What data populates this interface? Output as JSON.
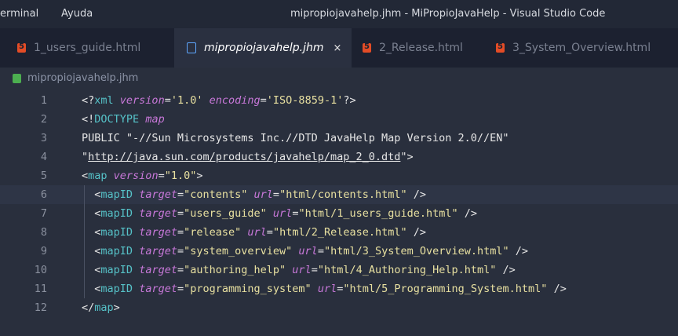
{
  "menu": {
    "terminal": "erminal",
    "help": "Ayuda"
  },
  "window": {
    "title": "mipropiojavahelp.jhm - MiPropioJavaHelp - Visual Studio Code"
  },
  "tabs": [
    {
      "label": "1_users_guide.html",
      "icon": "html5-icon",
      "active": false
    },
    {
      "label": "mipropiojavahelp.jhm",
      "icon": "file-icon",
      "active": true,
      "close": "×"
    },
    {
      "label": "2_Release.html",
      "icon": "html5-icon",
      "active": false
    },
    {
      "label": "3_System_Overview.html",
      "icon": "html5-icon",
      "active": false
    }
  ],
  "breadcrumb": {
    "file": "mipropiojavahelp.jhm"
  },
  "editor": {
    "current_line": 6,
    "line_numbers": [
      "1",
      "2",
      "3",
      "4",
      "5",
      "6",
      "7",
      "8",
      "9",
      "10",
      "11",
      "12"
    ],
    "lines": [
      [
        [
          "punc",
          "<?"
        ],
        [
          "tag",
          "xml"
        ],
        [
          "text",
          " "
        ],
        [
          "attr",
          "version"
        ],
        [
          "punc",
          "="
        ],
        [
          "str",
          "'1.0'"
        ],
        [
          "text",
          " "
        ],
        [
          "attr",
          "encoding"
        ],
        [
          "punc",
          "="
        ],
        [
          "str",
          "'ISO-8859-1'"
        ],
        [
          "punc",
          "?>"
        ]
      ],
      [
        [
          "punc",
          "<!"
        ],
        [
          "tag",
          "DOCTYPE"
        ],
        [
          "text",
          " "
        ],
        [
          "attr",
          "map"
        ]
      ],
      [
        [
          "text",
          "PUBLIC \"-//Sun Microsystems Inc.//DTD JavaHelp Map Version 2.0//EN\""
        ]
      ],
      [
        [
          "text",
          "\""
        ],
        [
          "url",
          "http://java.sun.com/products/javahelp/map_2_0.dtd"
        ],
        [
          "text",
          "\""
        ],
        [
          "punc",
          ">"
        ]
      ],
      [
        [
          "punc",
          "<"
        ],
        [
          "tag",
          "map"
        ],
        [
          "text",
          " "
        ],
        [
          "attr",
          "version"
        ],
        [
          "punc",
          "="
        ],
        [
          "str",
          "\"1.0\""
        ],
        [
          "punc",
          ">"
        ]
      ],
      [
        [
          "text",
          "  "
        ],
        [
          "punc",
          "<"
        ],
        [
          "tag",
          "mapID"
        ],
        [
          "text",
          " "
        ],
        [
          "attr",
          "target"
        ],
        [
          "punc",
          "="
        ],
        [
          "str",
          "\"contents\""
        ],
        [
          "text",
          " "
        ],
        [
          "attr",
          "url"
        ],
        [
          "punc",
          "="
        ],
        [
          "str",
          "\"html/contents.html\""
        ],
        [
          "text",
          " "
        ],
        [
          "punc",
          "/>"
        ]
      ],
      [
        [
          "text",
          "  "
        ],
        [
          "punc",
          "<"
        ],
        [
          "tag",
          "mapID"
        ],
        [
          "text",
          " "
        ],
        [
          "attr",
          "target"
        ],
        [
          "punc",
          "="
        ],
        [
          "str",
          "\"users_guide\""
        ],
        [
          "text",
          " "
        ],
        [
          "attr",
          "url"
        ],
        [
          "punc",
          "="
        ],
        [
          "str",
          "\"html/1_users_guide.html\""
        ],
        [
          "text",
          " "
        ],
        [
          "punc",
          "/>"
        ]
      ],
      [
        [
          "text",
          "  "
        ],
        [
          "punc",
          "<"
        ],
        [
          "tag",
          "mapID"
        ],
        [
          "text",
          " "
        ],
        [
          "attr",
          "target"
        ],
        [
          "punc",
          "="
        ],
        [
          "str",
          "\"release\""
        ],
        [
          "text",
          " "
        ],
        [
          "attr",
          "url"
        ],
        [
          "punc",
          "="
        ],
        [
          "str",
          "\"html/2_Release.html\""
        ],
        [
          "text",
          " "
        ],
        [
          "punc",
          "/>"
        ]
      ],
      [
        [
          "text",
          "  "
        ],
        [
          "punc",
          "<"
        ],
        [
          "tag",
          "mapID"
        ],
        [
          "text",
          " "
        ],
        [
          "attr",
          "target"
        ],
        [
          "punc",
          "="
        ],
        [
          "str",
          "\"system_overview\""
        ],
        [
          "text",
          " "
        ],
        [
          "attr",
          "url"
        ],
        [
          "punc",
          "="
        ],
        [
          "str",
          "\"html/3_System_Overview.html\""
        ],
        [
          "text",
          " "
        ],
        [
          "punc",
          "/>"
        ]
      ],
      [
        [
          "text",
          "  "
        ],
        [
          "punc",
          "<"
        ],
        [
          "tag",
          "mapID"
        ],
        [
          "text",
          " "
        ],
        [
          "attr",
          "target"
        ],
        [
          "punc",
          "="
        ],
        [
          "str",
          "\"authoring_help\""
        ],
        [
          "text",
          " "
        ],
        [
          "attr",
          "url"
        ],
        [
          "punc",
          "="
        ],
        [
          "str",
          "\"html/4_Authoring_Help.html\""
        ],
        [
          "text",
          " "
        ],
        [
          "punc",
          "/>"
        ]
      ],
      [
        [
          "text",
          "  "
        ],
        [
          "punc",
          "<"
        ],
        [
          "tag",
          "mapID"
        ],
        [
          "text",
          " "
        ],
        [
          "attr",
          "target"
        ],
        [
          "punc",
          "="
        ],
        [
          "str",
          "\"programming_system\""
        ],
        [
          "text",
          " "
        ],
        [
          "attr",
          "url"
        ],
        [
          "punc",
          "="
        ],
        [
          "str",
          "\"html/5_Programming_System.html\""
        ],
        [
          "text",
          " "
        ],
        [
          "punc",
          "/>"
        ]
      ],
      [
        [
          "punc",
          "</"
        ],
        [
          "tag",
          "map"
        ],
        [
          "punc",
          ">"
        ]
      ]
    ]
  }
}
